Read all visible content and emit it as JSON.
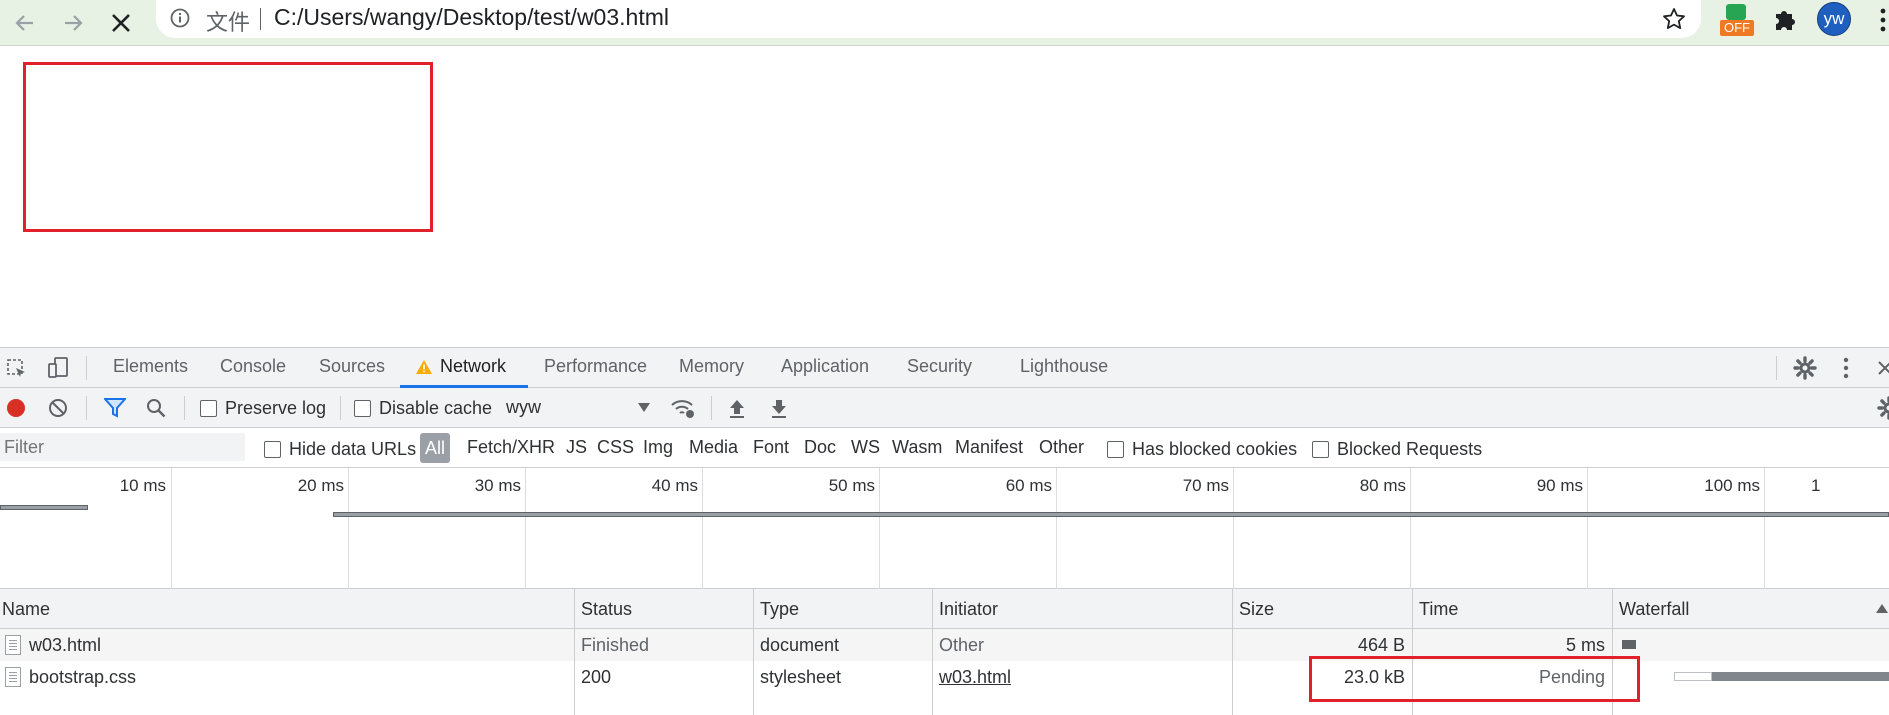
{
  "browser": {
    "url_prefix": "文件",
    "url": "C:/Users/wangy/Desktop/test/w03.html",
    "extension_badge": "OFF",
    "avatar_initials": "yw"
  },
  "devtools": {
    "tabs": [
      "Elements",
      "Console",
      "Sources",
      "Network",
      "Performance",
      "Memory",
      "Application",
      "Security",
      "Lighthouse"
    ],
    "active_tab": "Network",
    "toolbar": {
      "preserve_log": "Preserve log",
      "disable_cache": "Disable cache",
      "throttle_value": "wyw"
    },
    "filter": {
      "placeholder": "Filter",
      "hide_data_urls": "Hide data URLs",
      "types": [
        "All",
        "Fetch/XHR",
        "JS",
        "CSS",
        "Img",
        "Media",
        "Font",
        "Doc",
        "WS",
        "Wasm",
        "Manifest",
        "Other"
      ],
      "has_blocked_cookies": "Has blocked cookies",
      "blocked_requests": "Blocked Requests"
    },
    "overview": {
      "ticks": [
        "10 ms",
        "20 ms",
        "30 ms",
        "40 ms",
        "50 ms",
        "60 ms",
        "70 ms",
        "80 ms",
        "90 ms",
        "100 ms",
        "1"
      ]
    },
    "table": {
      "columns": [
        "Name",
        "Status",
        "Type",
        "Initiator",
        "Size",
        "Time",
        "Waterfall"
      ],
      "rows": [
        {
          "name": "w03.html",
          "status": "Finished",
          "type": "document",
          "initiator": "Other",
          "size": "464 B",
          "time": "5 ms"
        },
        {
          "name": "bootstrap.css",
          "status": "200",
          "type": "stylesheet",
          "initiator": "w03.html",
          "size": "23.0 kB",
          "time": "Pending"
        }
      ]
    }
  },
  "colors": {
    "accent": "#1a73e8",
    "highlight_red": "#e0202a",
    "record_red": "#d93025",
    "warning": "#f9ab00"
  }
}
